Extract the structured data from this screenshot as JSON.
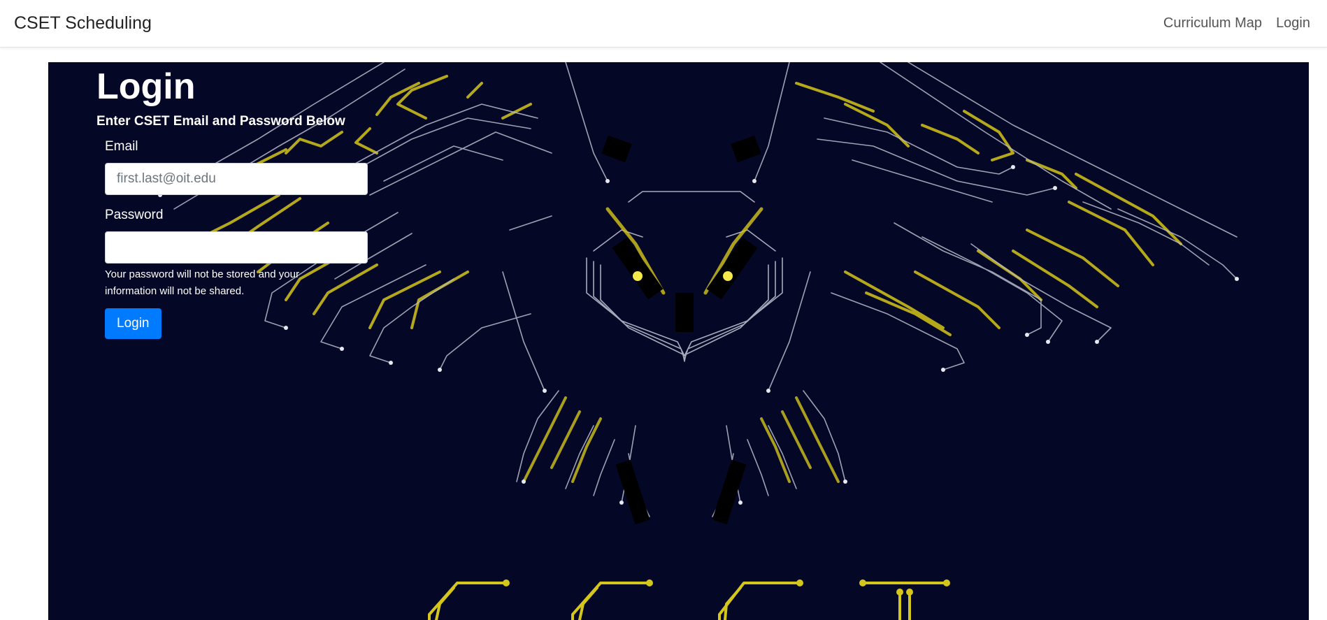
{
  "navbar": {
    "brand": "CSET Scheduling",
    "links": [
      {
        "label": "Curriculum Map"
      },
      {
        "label": "Login"
      }
    ]
  },
  "login": {
    "title": "Login",
    "subtitle": "Enter CSET Email and Password Below",
    "email_label": "Email",
    "email_placeholder": "first.last@oit.edu",
    "email_value": "",
    "password_label": "Password",
    "password_value": "",
    "hint": "Your password will not be stored and your information will not be shared.",
    "button_label": "Login"
  },
  "colors": {
    "hero_background": "#050726",
    "circuit_yellow": "#d4c61a",
    "circuit_trace": "#b8bccb",
    "primary_button": "#007bff"
  },
  "background_image": {
    "icon": "circuit-owl-illustration"
  }
}
